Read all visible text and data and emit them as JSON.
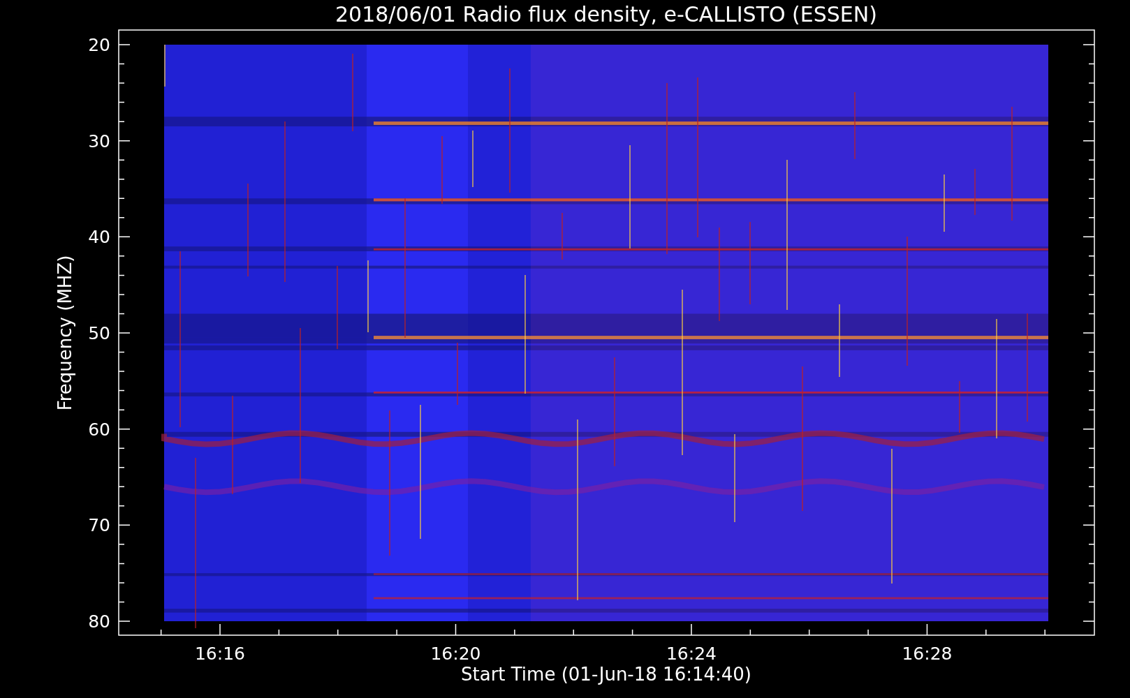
{
  "title": "2018/06/01  Radio flux density, e-CALLISTO (ESSEN)",
  "y_axis": {
    "label": "Frequency (MHZ)",
    "ticks": [
      "20",
      "30",
      "40",
      "50",
      "60",
      "70",
      "80"
    ]
  },
  "x_axis": {
    "label": "Start Time (01-Jun-18 16:14:40)",
    "ticks": [
      "16:16",
      "16:20",
      "16:24",
      "16:28"
    ]
  }
}
